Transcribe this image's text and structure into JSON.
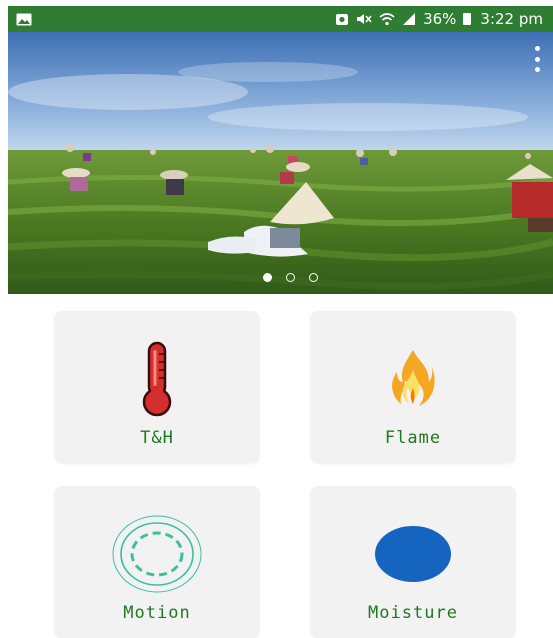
{
  "status_bar": {
    "battery": "36%",
    "time": "3:22 pm",
    "icons": [
      "image-icon",
      "alarm-icon",
      "mute-icon",
      "wifi-icon",
      "signal-icon",
      "battery-icon"
    ]
  },
  "banner": {
    "slide_count": 3,
    "active_slide": 1
  },
  "tiles": [
    {
      "label": "T&H",
      "icon": "thermometer-icon"
    },
    {
      "label": "Flame",
      "icon": "flame-icon"
    },
    {
      "label": "Motion",
      "icon": "motion-sensor-icon"
    },
    {
      "label": "Moisture",
      "icon": "moisture-drop-icon"
    }
  ],
  "colors": {
    "status_bar": "#2e7d32",
    "tile_label": "#1e7a1e",
    "tile_background": "#f2f2f2",
    "thermometer": "#d32f2f",
    "motion": "#3dbf9c",
    "moisture": "#1565c0"
  }
}
